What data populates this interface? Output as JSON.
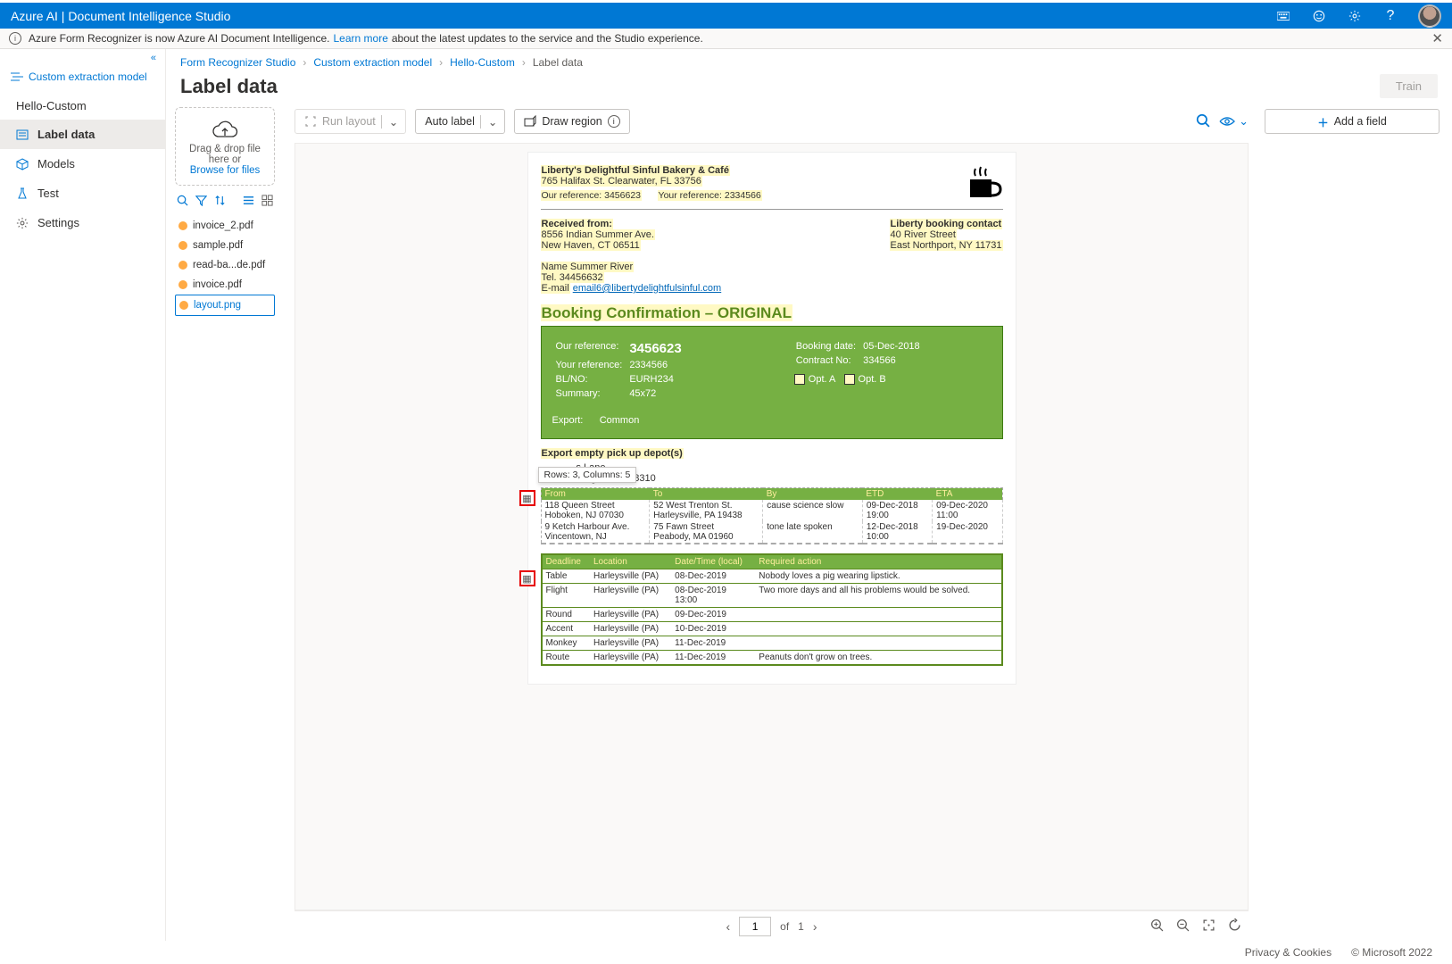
{
  "header": {
    "title": "Azure AI | Document Intelligence Studio"
  },
  "notice": {
    "prefix": "Azure Form Recognizer is now Azure AI Document Intelligence.",
    "link_text": "Learn more",
    "suffix": "about the latest updates to the service and the Studio experience."
  },
  "sidebar": {
    "model_type": "Custom extraction model",
    "project": "Hello-Custom",
    "items": [
      {
        "label": "Label data",
        "icon": "label-icon"
      },
      {
        "label": "Models",
        "icon": "cube-icon"
      },
      {
        "label": "Test",
        "icon": "flask-icon"
      },
      {
        "label": "Settings",
        "icon": "gear-icon"
      }
    ]
  },
  "breadcrumbs": {
    "items": [
      "Form Recognizer Studio",
      "Custom extraction model",
      "Hello-Custom",
      "Label data"
    ]
  },
  "page_title": "Label data",
  "train_button": "Train",
  "dropzone": {
    "line1": "Drag & drop file",
    "line2": "here or",
    "browse": "Browse for files"
  },
  "files": [
    "invoice_2.pdf",
    "sample.pdf",
    "read-ba...de.pdf",
    "invoice.pdf",
    "layout.png"
  ],
  "toolbar": {
    "run_layout": "Run layout",
    "auto_label": "Auto label",
    "draw_region": "Draw region"
  },
  "add_field": "Add a field",
  "tooltip_text": "Rows: 3, Columns: 5",
  "pager": {
    "page": "1",
    "of_label": "of",
    "total": "1"
  },
  "document": {
    "company": "Liberty's Delightful Sinful Bakery & Café",
    "address": "765 Halifax St. Clearwater, FL 33756",
    "our_ref_label": "Our reference:",
    "our_ref": "3456623",
    "your_ref_label": "Your reference:",
    "your_ref": "2334566",
    "received_from_label": "Received from:",
    "rf_addr1": "8556 Indian Summer Ave.",
    "rf_addr2": "New Haven, CT 06511",
    "contact_name_label": "Name",
    "contact_name": "Summer River",
    "contact_tel_label": "Tel.",
    "contact_tel": "34456632",
    "contact_email_label": "E-mail",
    "contact_email": "email6@libertydelightfulsinful.com",
    "booking_contact_label": "Liberty booking contact",
    "bc_addr1": "40 River Street",
    "bc_addr2": "East Northport, NY 11731",
    "confirm_title": "Booking Confirmation – ORIGINAL",
    "box": {
      "our_ref_label": "Our reference:",
      "our_ref": "3456623",
      "your_ref_label": "Your reference:",
      "your_ref": "2334566",
      "blno_label": "BL/NO:",
      "blno": "EURH234",
      "summary_label": "Summary:",
      "summary": "45x72",
      "booking_date_label": "Booking date:",
      "booking_date": "05-Dec-2018",
      "contract_no_label": "Contract No:",
      "contract_no": "334566",
      "opt_a": "Opt. A",
      "opt_b": "Opt. B",
      "export_label": "Export:",
      "export": "Common"
    },
    "depot_title": "Export empty pick up depot(s)",
    "depot_snip1": "s Lane",
    "depot_snip2": "Heights, MI 48310",
    "depot_headers": [
      "From",
      "To",
      "By",
      "ETD",
      "ETA"
    ],
    "depot_rows": [
      [
        "118 Queen Street\nHoboken, NJ 07030",
        "52 West Trenton St.\nHarleysville, PA 19438",
        "cause science slow",
        "09-Dec-2018\n19:00",
        "09-Dec-2020\n11:00"
      ],
      [
        "9 Ketch Harbour Ave.\nVincentown, NJ",
        "75 Fawn Street\nPeabody, MA 01960",
        "tone late spoken",
        "12-Dec-2018\n10:00",
        "19-Dec-2020"
      ]
    ],
    "sched_headers": [
      "Deadline",
      "Location",
      "Date/Time (local)",
      "Required action"
    ],
    "sched_rows": [
      [
        "Table",
        "Harleysville (PA)",
        "08-Dec-2019",
        "Nobody loves a pig wearing lipstick."
      ],
      [
        "Flight",
        "Harleysville (PA)",
        "08-Dec-2019\n13:00",
        "Two more days and all his problems would be solved."
      ],
      [
        "Round",
        "Harleysville (PA)",
        "09-Dec-2019",
        ""
      ],
      [
        "Accent",
        "Harleysville (PA)",
        "10-Dec-2019",
        ""
      ],
      [
        "Monkey",
        "Harleysville (PA)",
        "11-Dec-2019",
        ""
      ],
      [
        "Route",
        "Harleysville (PA)",
        "11-Dec-2019",
        "Peanuts don't grow on trees."
      ]
    ]
  },
  "footer": {
    "privacy": "Privacy & Cookies",
    "copyright": "© Microsoft 2022"
  }
}
